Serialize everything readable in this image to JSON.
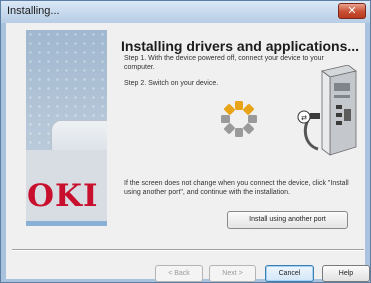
{
  "window": {
    "title": "Installing...",
    "close_glyph": "✕"
  },
  "brand": {
    "logo_text": "OKI",
    "logo_color": "#c8102e"
  },
  "content": {
    "heading": "Installing drivers and applications...",
    "step1": "Step 1. With the device powered off, connect your device to your computer.",
    "step2": "Step 2. Switch on your device.",
    "info": "If the screen does not change when you connect the device, click \"Install using another port\", and continue with the installation.",
    "port_button_label": "Install using another port",
    "spinner_icon": "loading-spinner-icon",
    "illustration_icon": "computer-usb-cable-icon"
  },
  "footer": {
    "back_label": "< Back",
    "next_label": "Next >",
    "cancel_label": "Cancel",
    "help_label": "Help"
  },
  "colors": {
    "accent": "#3c7fb1",
    "spinner_active": "#e8a317",
    "spinner_inactive": "#9a9a9a"
  }
}
